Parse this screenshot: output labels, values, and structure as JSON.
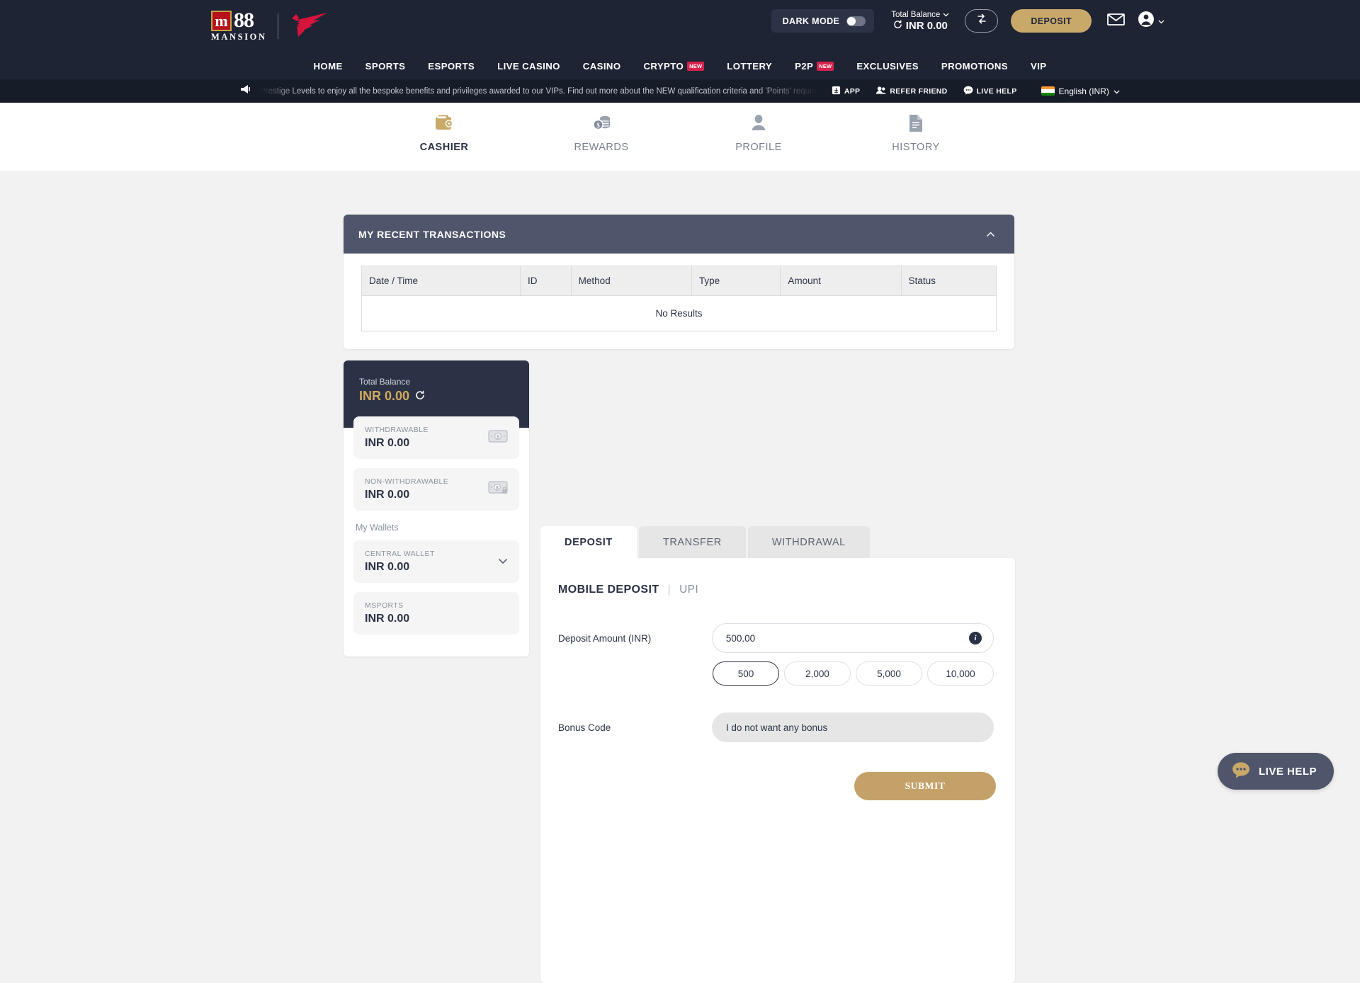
{
  "brand": {
    "logo_mark": "m",
    "logo_digits": "88",
    "logo_word": "MANSION",
    "bird_icon": "phoenix-bird-logo"
  },
  "header": {
    "dark_mode_label": "DARK MODE",
    "dark_mode_on": false,
    "balance_label": "Total Balance",
    "balance_value": "INR 0.00",
    "swap_icon": "swap-arrows-icon",
    "deposit_label": "DEPOSIT",
    "mail_icon": "envelope-icon",
    "account_icon": "user-circle-icon",
    "chevron_icon": "chevron-down-icon"
  },
  "nav": {
    "items": [
      {
        "label": "HOME",
        "badge": ""
      },
      {
        "label": "SPORTS",
        "badge": ""
      },
      {
        "label": "ESPORTS",
        "badge": ""
      },
      {
        "label": "LIVE CASINO",
        "badge": ""
      },
      {
        "label": "CASINO",
        "badge": ""
      },
      {
        "label": "CRYPTO",
        "badge": "NEW"
      },
      {
        "label": "LOTTERY",
        "badge": ""
      },
      {
        "label": "P2P",
        "badge": "NEW"
      },
      {
        "label": "EXCLUSIVES",
        "badge": ""
      },
      {
        "label": "PROMOTIONS",
        "badge": ""
      },
      {
        "label": "VIP",
        "badge": ""
      }
    ]
  },
  "announcement": {
    "megaphone_icon": "megaphone-icon",
    "text": "Prestige Levels to enjoy all the bespoke benefits and privileges awarded to our VIPs. Find out more about the NEW qualification criteria and 'Points' require",
    "links": [
      {
        "label": "APP",
        "icon": "download-app-icon"
      },
      {
        "label": "REFER FRIEND",
        "icon": "people-icon"
      },
      {
        "label": "LIVE HELP",
        "icon": "chat-bubble-icon"
      }
    ],
    "language": "English (INR)",
    "flag_icon": "india-flag-icon",
    "lang_chevron": "chevron-down-icon"
  },
  "tabs": [
    {
      "label": "CASHIER",
      "icon": "wallet-icon",
      "active": true
    },
    {
      "label": "REWARDS",
      "icon": "coins-icon",
      "active": false
    },
    {
      "label": "PROFILE",
      "icon": "person-icon",
      "active": false
    },
    {
      "label": "HISTORY",
      "icon": "document-icon",
      "active": false
    }
  ],
  "transactions": {
    "title": "MY RECENT TRANSACTIONS",
    "collapse_icon": "chevron-up-icon",
    "columns": [
      "Date / Time",
      "ID",
      "Method",
      "Type",
      "Amount",
      "Status"
    ],
    "rows": [],
    "empty_text": "No Results"
  },
  "balance_panel": {
    "total_label": "Total Balance",
    "total_value": "INR 0.00",
    "refresh_icon": "refresh-icon",
    "cards": [
      {
        "label": "WITHDRAWABLE",
        "value": "INR 0.00",
        "icon": "banknote-icon"
      },
      {
        "label": "NON-WITHDRAWABLE",
        "value": "INR 0.00",
        "icon": "banknote-lock-icon"
      }
    ],
    "my_wallets_label": "My Wallets",
    "wallets": [
      {
        "label": "CENTRAL WALLET",
        "value": "INR 0.00",
        "icon": "chevron-down-icon"
      },
      {
        "label": "MSPORTS",
        "value": "INR 0.00",
        "icon": ""
      }
    ]
  },
  "deposit": {
    "tabs": [
      {
        "label": "DEPOSIT",
        "active": true
      },
      {
        "label": "TRANSFER",
        "active": false
      },
      {
        "label": "WITHDRAWAL",
        "active": false
      }
    ],
    "method_title": "MOBILE DEPOSIT",
    "method_sep": "|",
    "method_sub": "UPI",
    "amount_label": "Deposit Amount (INR)",
    "amount_value": "500.00",
    "amount_placeholder": "500.00",
    "info_icon": "info-icon",
    "quick_amounts": [
      "500",
      "2,000",
      "5,000",
      "10,000"
    ],
    "quick_selected": "500",
    "bonus_label": "Bonus Code",
    "bonus_value": "I do not want any bonus",
    "submit_label": "SUBMIT"
  },
  "fab": {
    "label": "LIVE HELP",
    "icon": "chat-dots-icon"
  },
  "colors": {
    "header_bg": "#1e2433",
    "marquee_bg": "#171c29",
    "accent_gold": "#c9a96a",
    "panel_head": "#4f566b",
    "brand_red": "#d6244e",
    "logo_red": "#b5121b",
    "balance_gold": "#d2aa5e"
  }
}
